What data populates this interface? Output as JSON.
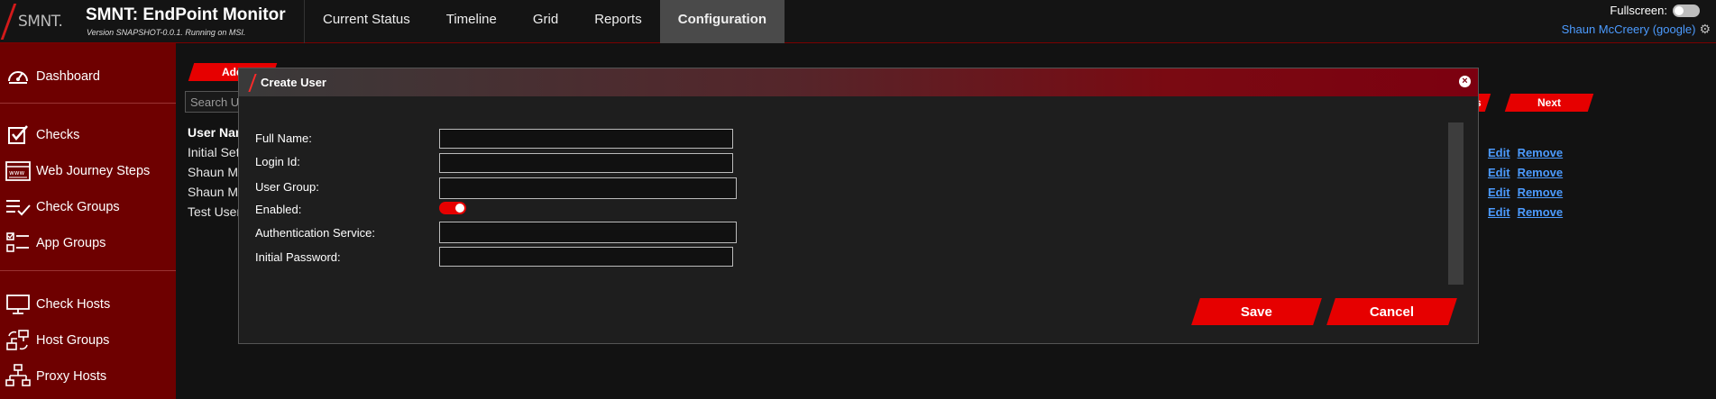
{
  "header": {
    "logo_text": "SMNT.",
    "title": "SMNT: EndPoint Monitor",
    "version": "Version SNAPSHOT-0.0.1. Running on MSI.",
    "tabs": [
      {
        "label": "Current Status"
      },
      {
        "label": "Timeline"
      },
      {
        "label": "Grid"
      },
      {
        "label": "Reports"
      },
      {
        "label": "Configuration",
        "active": true
      }
    ],
    "fullscreen_label": "Fullscreen:",
    "user": "Shaun McCreery (google)"
  },
  "sidebar": {
    "items": [
      {
        "label": "Dashboard",
        "icon": "dashboard-gauge-icon"
      },
      {
        "label": "Checks",
        "icon": "checkbox-icon"
      },
      {
        "label": "Web Journey Steps",
        "icon": "browser-www-icon"
      },
      {
        "label": "Check Groups",
        "icon": "checklist-icon"
      },
      {
        "label": "App Groups",
        "icon": "app-groups-list-icon"
      },
      {
        "label": "Check Hosts",
        "icon": "monitor-icon"
      },
      {
        "label": "Host Groups",
        "icon": "host-groups-icon"
      },
      {
        "label": "Proxy Hosts",
        "icon": "network-proxy-icon"
      }
    ]
  },
  "main": {
    "add_button": "Add",
    "search_placeholder": "Search U",
    "table_header": "User Nam",
    "rows": [
      "Initial Set",
      "Shaun Mc",
      "Shaun Mc",
      "Test User"
    ],
    "edit_label": "Edit",
    "remove_label": "Remove",
    "prev_label": "s",
    "next_label": "Next"
  },
  "modal": {
    "title": "Create User",
    "fields": {
      "full_name": {
        "label": "Full Name:",
        "value": ""
      },
      "login_id": {
        "label": "Login Id:",
        "value": ""
      },
      "user_group": {
        "label": "User Group:",
        "value": ""
      },
      "enabled": {
        "label": "Enabled:",
        "value": true
      },
      "auth_service": {
        "label": "Authentication Service:",
        "value": ""
      },
      "initial_password": {
        "label": "Initial Password:",
        "value": ""
      }
    },
    "save_label": "Save",
    "cancel_label": "Cancel"
  },
  "colors": {
    "accent": "#e60000",
    "sidebar_bg": "#6e0000",
    "link": "#4c9bff",
    "background": "#121212"
  }
}
